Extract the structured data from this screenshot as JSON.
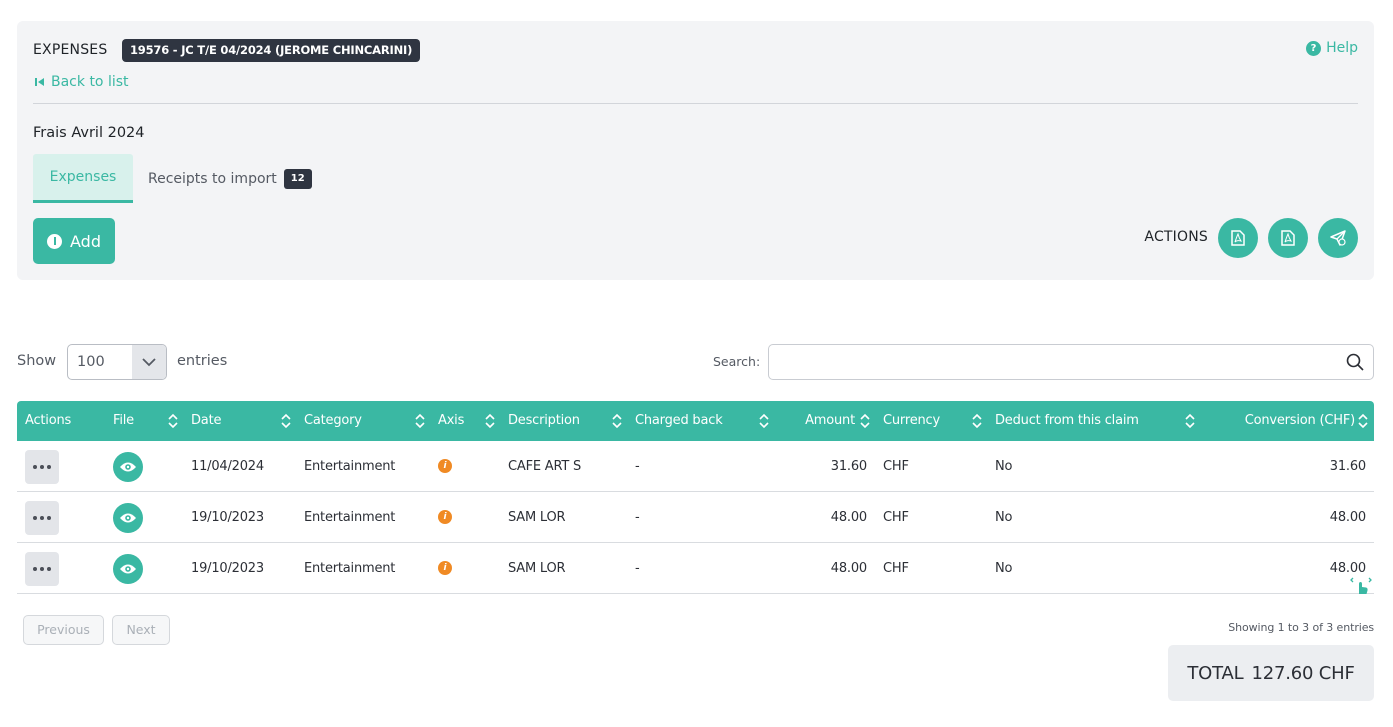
{
  "header": {
    "title": "EXPENSES",
    "badge": "19576 - JC T/E 04/2024 (JEROME CHINCARINI)",
    "help_label": "Help",
    "back_label": "Back to list",
    "claim_name": "Frais Avril 2024"
  },
  "tabs": [
    {
      "label": "Expenses",
      "active": true
    },
    {
      "label": "Receipts to import",
      "count": "12"
    }
  ],
  "toolbar": {
    "add_label": "Add",
    "actions_label": "ACTIONS",
    "action_icons": [
      "pdf-icon",
      "pdf-icon",
      "send-icon"
    ]
  },
  "table_controls": {
    "show_label": "Show",
    "entries_value": "100",
    "entries_label": "entries",
    "search_label": "Search:",
    "search_value": ""
  },
  "columns": [
    "Actions",
    "File",
    "Date",
    "Category",
    "Axis",
    "Description",
    "Charged back",
    "Amount",
    "Currency",
    "Deduct from this claim",
    "Conversion (CHF)"
  ],
  "rows": [
    {
      "date": "11/04/2024",
      "category": "Entertainment",
      "description": "CAFE ART S",
      "charged_back": "-",
      "amount": "31.60",
      "currency": "CHF",
      "deduct": "No",
      "conversion": "31.60"
    },
    {
      "date": "19/10/2023",
      "category": "Entertainment",
      "description": "SAM LOR",
      "charged_back": "-",
      "amount": "48.00",
      "currency": "CHF",
      "deduct": "No",
      "conversion": "48.00"
    },
    {
      "date": "19/10/2023",
      "category": "Entertainment",
      "description": "SAM LOR",
      "charged_back": "-",
      "amount": "48.00",
      "currency": "CHF",
      "deduct": "No",
      "conversion": "48.00"
    }
  ],
  "pagination": {
    "previous_label": "Previous",
    "next_label": "Next",
    "info": "Showing 1 to 3 of 3 entries"
  },
  "total": {
    "label": "TOTAL",
    "value": "127.60 CHF"
  },
  "colors": {
    "accent": "#3ab8a3",
    "dark_badge": "#2f3541",
    "axis_icon": "#f08a24"
  }
}
